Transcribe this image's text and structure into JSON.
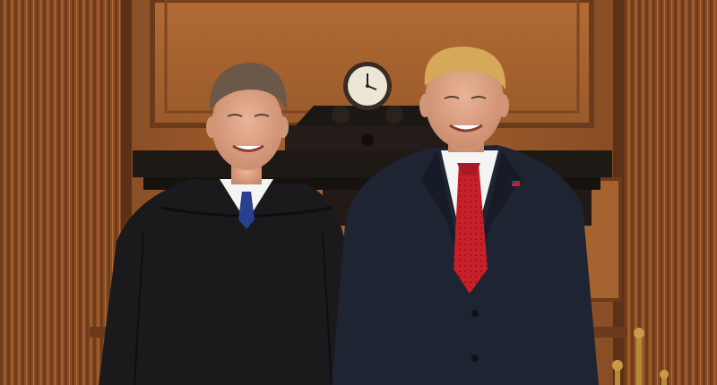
{
  "scene": {
    "colors": {
      "wood_dark": "#6b3a1c",
      "wood_mid": "#a0602e",
      "wood_light": "#c27a3d",
      "mantel": "#1d1714",
      "robe": "#1a1a1c",
      "suit": "#1f2433",
      "shirt": "#f4f4f2",
      "tie_left": "#2a3f8f",
      "tie_right": "#c8202b",
      "skin": "#e0a88a",
      "hair_left": "#6b5848",
      "hair_right": "#d6a85a",
      "brass": "#b58a3a",
      "clock_face": "#ece6d6"
    },
    "icons": [
      "lapel-pin-icon",
      "clock-face-icon"
    ]
  }
}
